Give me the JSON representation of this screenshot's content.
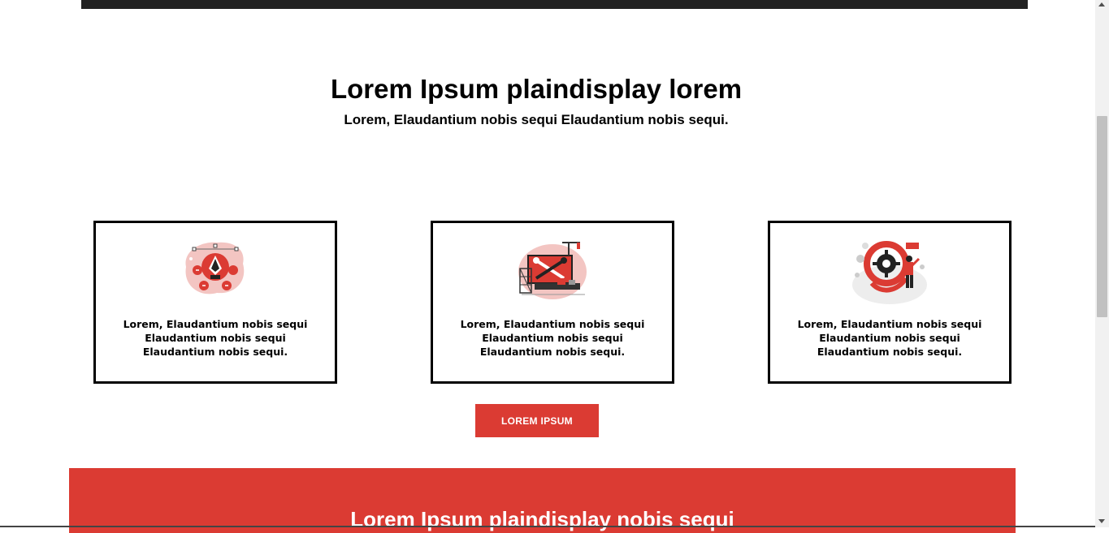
{
  "header": {
    "title": "Lorem Ipsum plaindisplay lorem",
    "subtitle": "Lorem, Elaudantium nobis sequi Elaudantium nobis sequi."
  },
  "cards": [
    {
      "icon": "pen-tool-illustration-icon",
      "text": "Lorem, Elaudantium nobis sequi Elaudantium nobis sequi Elaudantium nobis sequi."
    },
    {
      "icon": "tools-construction-illustration-icon",
      "text": "Lorem, Elaudantium nobis sequi Elaudantium nobis sequi Elaudantium nobis sequi."
    },
    {
      "icon": "gear-settings-illustration-icon",
      "text": "Lorem, Elaudantium nobis sequi Elaudantium nobis sequi Elaudantium nobis sequi."
    }
  ],
  "cta": {
    "label": "LOREM IPSUM"
  },
  "section2": {
    "title": "Lorem Ipsum plaindisplay nobis sequi"
  },
  "colors": {
    "accent": "#db3b33",
    "dark": "#222222",
    "pale_accent": "#f3c5c2"
  }
}
